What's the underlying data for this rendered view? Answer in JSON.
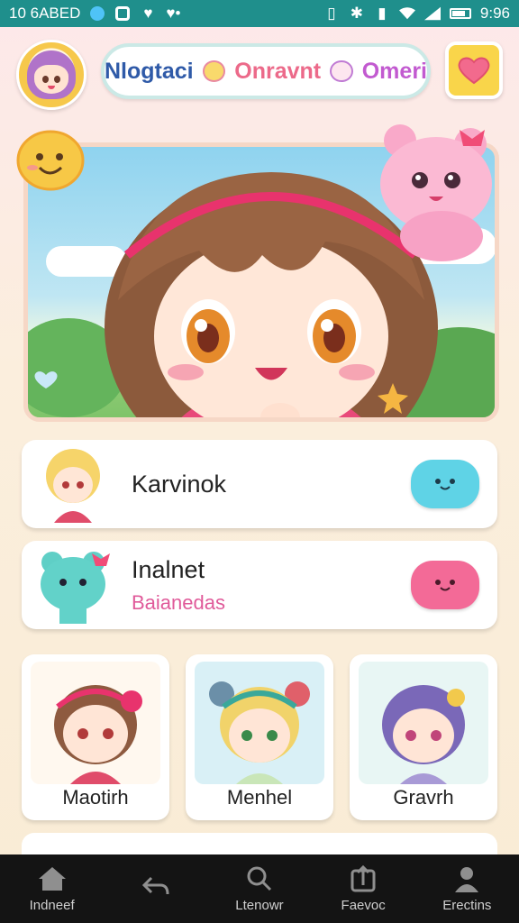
{
  "status_bar": {
    "time_left": "10 6ABED",
    "time_right": "9:96"
  },
  "header": {
    "title_part1": "Nlogtaci",
    "title_part2": "Onravnt",
    "title_part3": "Omeri"
  },
  "list": [
    {
      "title": "Karvinok",
      "subtitle": ""
    },
    {
      "title": "Inalnet",
      "subtitle": "Baianedas"
    }
  ],
  "grid": [
    {
      "label": "Maotirh"
    },
    {
      "label": "Menhel"
    },
    {
      "label": "Gravrh"
    }
  ],
  "bottom_nav": [
    {
      "label": "Indneef",
      "icon": "home-icon"
    },
    {
      "label": "",
      "icon": "back-arrow-icon"
    },
    {
      "label": "Ltenowr",
      "icon": "search-icon"
    },
    {
      "label": "Faevoc",
      "icon": "upload-icon"
    },
    {
      "label": "Erectins",
      "icon": "profile-icon"
    }
  ],
  "colors": {
    "status_bar": "#1f8f8c",
    "accent_pink": "#f36a97",
    "accent_teal": "#5fd3e6",
    "nav_bg": "#141414"
  }
}
